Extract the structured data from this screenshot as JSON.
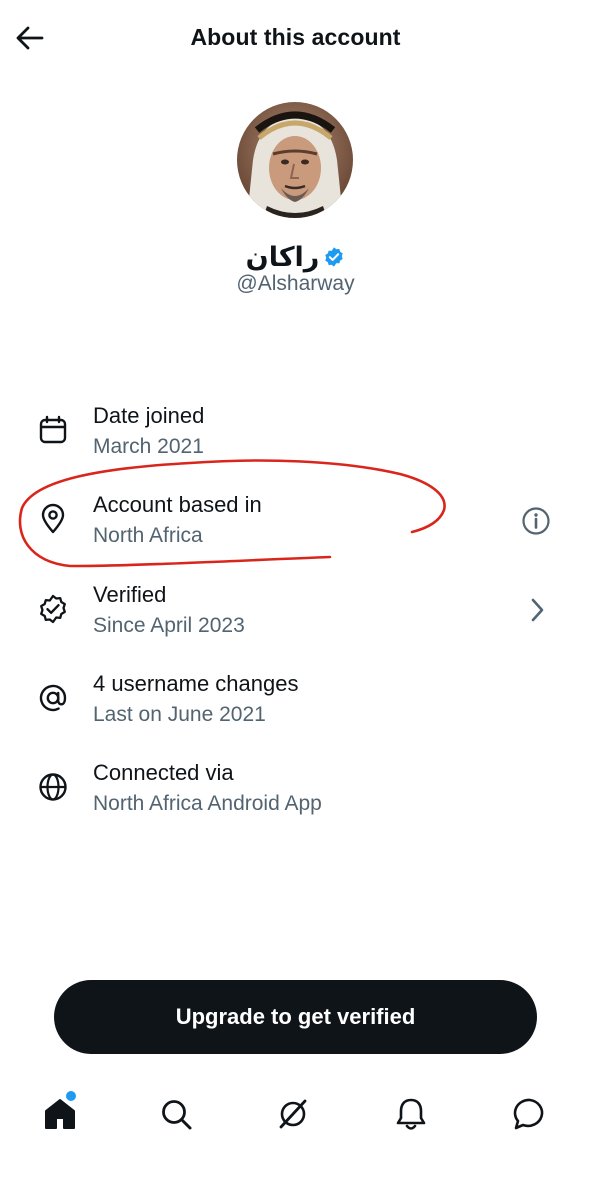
{
  "header": {
    "title": "About this account",
    "back_icon": "arrow-left-icon"
  },
  "profile": {
    "display_name": "راكان",
    "handle": "@Alsharway",
    "verified_badge_icon": "verified-badge-icon",
    "avatar_alt": "Profile photo"
  },
  "details": [
    {
      "icon": "calendar-icon",
      "title": "Date joined",
      "subtitle": "March 2021"
    },
    {
      "icon": "location-pin-icon",
      "title": "Account based in",
      "subtitle": "North Africa",
      "trailing_icon": "info-icon",
      "annotated": true
    },
    {
      "icon": "verified-outline-icon",
      "title": "Verified",
      "subtitle": "Since April 2023",
      "trailing_icon": "chevron-right-icon"
    },
    {
      "icon": "at-sign-icon",
      "title": "4 username changes",
      "subtitle": "Last on June 2021"
    },
    {
      "icon": "globe-icon",
      "title": "Connected via",
      "subtitle": "North Africa Android App"
    }
  ],
  "cta": {
    "label": "Upgrade to get verified"
  },
  "tabbar": {
    "items": [
      "home-icon",
      "search-icon",
      "grok-icon",
      "notifications-icon",
      "messages-icon"
    ],
    "home_has_notification_dot": true
  },
  "colors": {
    "text_primary": "#0f1419",
    "text_secondary": "#536471",
    "accent_blue": "#1d9bf0",
    "annotation_red": "#d9261c",
    "button_bg": "#0f1419"
  }
}
